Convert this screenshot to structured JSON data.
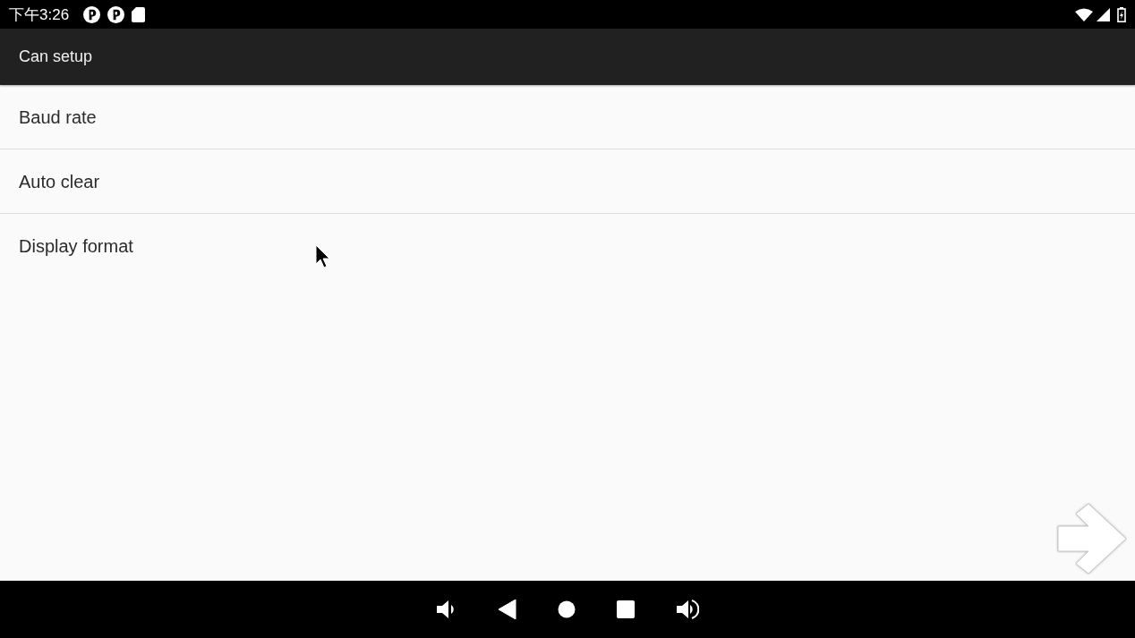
{
  "status_bar": {
    "time": "下午3:26"
  },
  "app_bar": {
    "title": "Can setup"
  },
  "settings": [
    {
      "label": "Baud rate"
    },
    {
      "label": "Auto clear"
    },
    {
      "label": "Display format"
    }
  ]
}
